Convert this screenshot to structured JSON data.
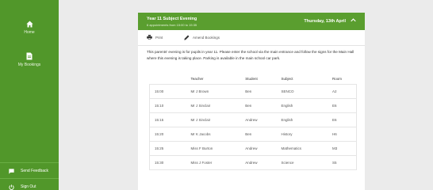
{
  "sidebar": {
    "home_label": "Home",
    "bookings_label": "My Bookings",
    "feedback_label": "Send Feedback",
    "signout_label": "Sign Out"
  },
  "event": {
    "title": "Year 11 Subject Evening",
    "subtitle": "6 appointments from 15:00 to 15:35",
    "date": "Thursday, 13th April"
  },
  "toolbar": {
    "print_label": "Print",
    "amend_label": "Amend Bookings"
  },
  "info_text": "This parents' evening is for pupils in year 11. Please enter the school via the main entrance and follow the signs for the Main Hall where this evening is taking place. Parking is available in the main school car park.",
  "table": {
    "headers": [
      "",
      "Teacher",
      "Student",
      "Subject",
      "Room"
    ],
    "rows": [
      {
        "time": "15:00",
        "teacher": "Mr J Brown",
        "student": "Ben",
        "subject": "SENCO",
        "room": "A2"
      },
      {
        "time": "15:10",
        "teacher": "Mr J Sinclair",
        "student": "Ben",
        "subject": "English",
        "room": "E6"
      },
      {
        "time": "15:15",
        "teacher": "Mr J Sinclair",
        "student": "Andrew",
        "subject": "English",
        "room": "E6"
      },
      {
        "time": "15:20",
        "teacher": "Mr K Jacobs",
        "student": "Ben",
        "subject": "History",
        "room": "H6"
      },
      {
        "time": "15:25",
        "teacher": "Miss F Burton",
        "student": "Andrew",
        "subject": "Mathematics",
        "room": "M3"
      },
      {
        "time": "15:30",
        "teacher": "Miss J Foster",
        "student": "Andrew",
        "subject": "Science",
        "room": "S5"
      }
    ]
  },
  "colors": {
    "sidebar": "#51972a",
    "banner": "#5a9e2f",
    "background": "#ebebeb"
  },
  "icons": {
    "home": "home-icon",
    "bookings": "document-icon",
    "feedback": "chat-icon",
    "signout": "power-icon",
    "print": "printer-icon",
    "amend": "pencil-icon",
    "collapse": "chevron-up-icon"
  }
}
